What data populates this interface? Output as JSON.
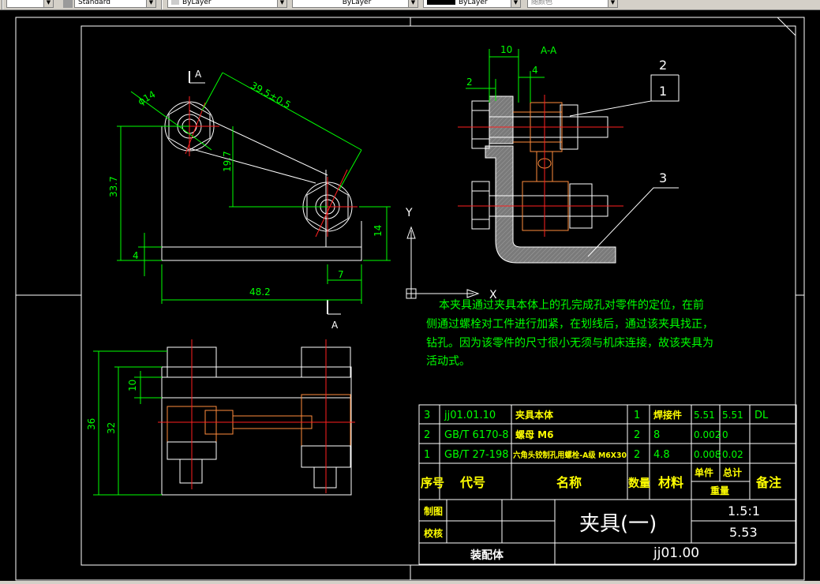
{
  "toolbar": {
    "textstyle_value": "Standard",
    "layer_value": "ByLayer",
    "linetype_value": "ByLayer",
    "lineweight_value": "ByLayer",
    "plotstyle_value": "随颜色"
  },
  "colors": {
    "background": "#000000",
    "frame": "#ffffff",
    "dimension": "#00ff00",
    "centerline": "#ff2020",
    "part_orange": "#ff8c3c",
    "hatch": "#7a7a7a",
    "note_text": "#00ff00",
    "table_text": "#00ff00",
    "table_label": "#ffff00",
    "title_text": "#ffffff"
  },
  "drawing": {
    "section_label": "A-A",
    "cut_label": "A",
    "dimensions": {
      "d10": "10",
      "d4": "4",
      "d2": "2",
      "phi14": "ϕ14",
      "d39": "39.5±0.5",
      "d19": "19.7",
      "d33": "33.7",
      "d14": "14",
      "d4b": "4",
      "d7": "7",
      "d48": "48.2",
      "d10b": "10",
      "d36": "36",
      "d32": "32"
    },
    "balloons": [
      "2",
      "1",
      "3"
    ],
    "ucs_y": "Y",
    "ucs_x": "X"
  },
  "note": {
    "lines": [
      "本夹具通过夹具本体上的孔完成孔对零件的定位，在前",
      "侧通过螺栓对工件进行加紧，在划线后，通过该夹具找正，",
      "钻孔。因为该零件的尺寸很小无须与机床连接，故该夹具为",
      "活动式。"
    ]
  },
  "bom": {
    "rows": [
      {
        "no": "3",
        "code": "jj01.01.10",
        "name": "夹具本体",
        "qty": "1",
        "material": "焊接件",
        "unit": "5.51",
        "total": "5.51",
        "remark": "DL"
      },
      {
        "no": "2",
        "code": "GB/T 6170-8",
        "name": "螺母 M6",
        "qty": "2",
        "material": "8",
        "unit": "0.002",
        "total": "0",
        "remark": ""
      },
      {
        "no": "1",
        "code": "GB/T 27-198",
        "name": "六角头铰制孔用螺栓-A级 M6X30",
        "qty": "2",
        "material": "4.8",
        "unit": "0.008",
        "total": "0.02",
        "remark": ""
      }
    ],
    "header": {
      "no": "序号",
      "code": "代号",
      "name": "名称",
      "qty": "数量",
      "material": "材料",
      "unit": "单件",
      "total": "总计",
      "weight": "重量",
      "remark": "备注"
    }
  },
  "titleblock": {
    "drawn_label": "制图",
    "checked_label": "校核",
    "title": "夹具(一)",
    "scale": "1.5:1",
    "weight": "5.53",
    "type_label": "装配体",
    "drawing_no": "jj01.00"
  }
}
